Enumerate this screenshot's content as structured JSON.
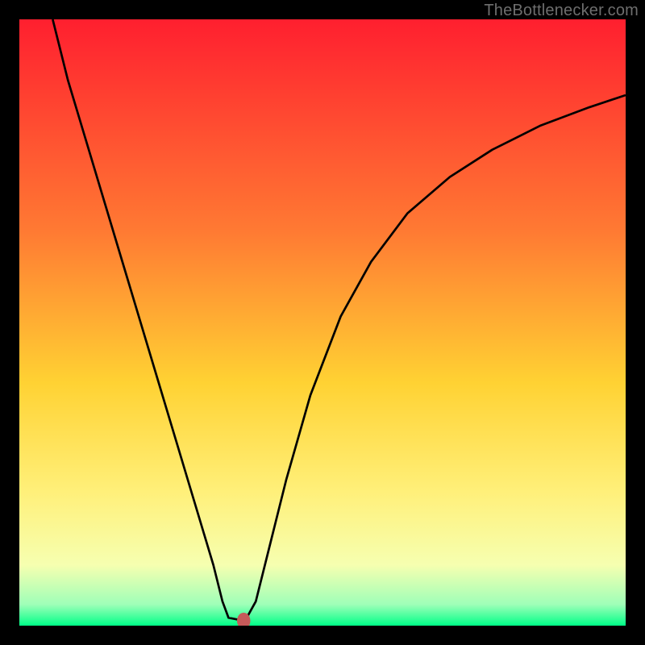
{
  "watermark": {
    "text": "TheBottlenecker.com"
  },
  "chart_data": {
    "type": "line",
    "title": "",
    "xlabel": "",
    "ylabel": "",
    "xlim": [
      0,
      100
    ],
    "ylim": [
      0,
      100
    ],
    "grid": false,
    "legend": false,
    "gradient_colors": [
      {
        "stop": 0.0,
        "color": "#ff1f2f"
      },
      {
        "stop": 0.35,
        "color": "#ff7a33"
      },
      {
        "stop": 0.6,
        "color": "#ffd233"
      },
      {
        "stop": 0.78,
        "color": "#fff07a"
      },
      {
        "stop": 0.9,
        "color": "#f6ffb0"
      },
      {
        "stop": 0.965,
        "color": "#9fffb8"
      },
      {
        "stop": 1.0,
        "color": "#00ff88"
      }
    ],
    "curve": {
      "stroke": "#000000",
      "stroke_width": 2.7,
      "points": [
        {
          "x": 5.5,
          "y": 100.0
        },
        {
          "x": 8.0,
          "y": 90.0
        },
        {
          "x": 11.0,
          "y": 80.0
        },
        {
          "x": 14.0,
          "y": 70.0
        },
        {
          "x": 17.0,
          "y": 60.0
        },
        {
          "x": 20.0,
          "y": 50.0
        },
        {
          "x": 23.0,
          "y": 40.0
        },
        {
          "x": 26.0,
          "y": 30.0
        },
        {
          "x": 29.0,
          "y": 20.0
        },
        {
          "x": 32.0,
          "y": 10.0
        },
        {
          "x": 33.5,
          "y": 4.0
        },
        {
          "x": 34.5,
          "y": 1.3
        },
        {
          "x": 36.0,
          "y": 1.0
        },
        {
          "x": 37.5,
          "y": 1.3
        },
        {
          "x": 39.0,
          "y": 4.0
        },
        {
          "x": 41.0,
          "y": 12.0
        },
        {
          "x": 44.0,
          "y": 24.0
        },
        {
          "x": 48.0,
          "y": 38.0
        },
        {
          "x": 53.0,
          "y": 51.0
        },
        {
          "x": 58.0,
          "y": 60.0
        },
        {
          "x": 64.0,
          "y": 68.0
        },
        {
          "x": 71.0,
          "y": 74.0
        },
        {
          "x": 78.0,
          "y": 78.5
        },
        {
          "x": 86.0,
          "y": 82.5
        },
        {
          "x": 94.0,
          "y": 85.5
        },
        {
          "x": 100.0,
          "y": 87.5
        }
      ]
    },
    "marker": {
      "x": 37.0,
      "y": 0.8,
      "rx": 1.1,
      "ry": 1.35,
      "fill": "#c65a5a"
    }
  }
}
